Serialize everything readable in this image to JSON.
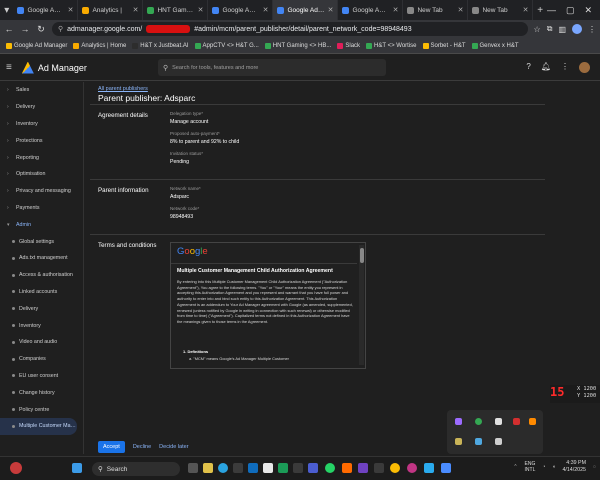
{
  "browser": {
    "tabs": [
      {
        "label": "Google A…",
        "color": "#4285f4"
      },
      {
        "label": "Analytics |",
        "color": "#f9ab00"
      },
      {
        "label": "HNT Gam…",
        "color": "#34a853"
      },
      {
        "label": "Google A…",
        "color": "#4285f4"
      },
      {
        "label": "Google Ad…",
        "color": "#4285f4"
      },
      {
        "label": "Google A…",
        "color": "#4285f4"
      },
      {
        "label": "New Tab",
        "color": "#888888"
      },
      {
        "label": "New Tab",
        "color": "#888888"
      }
    ],
    "url_host": "admanager.google.com/",
    "url_path": "#admin/mcm/parent_publisher/detail/parent_network_code=98948493",
    "bookmarks": [
      {
        "label": "Google Ad Manager",
        "color": "#fbbc04"
      },
      {
        "label": "Analytics | Home",
        "color": "#f9ab00"
      },
      {
        "label": "H&T  x Justbeat.AI",
        "color": "#2d2d2d"
      },
      {
        "label": "AppCTV <> H&T G...",
        "color": "#34a853"
      },
      {
        "label": "HNT Gaming <> HB...",
        "color": "#34a853"
      },
      {
        "label": "Slack",
        "color": "#e01e5a"
      },
      {
        "label": "H&T <> Wortise",
        "color": "#34a853"
      },
      {
        "label": "Sorbet - H&T",
        "color": "#fbbc04"
      },
      {
        "label": "Genvex x H&T",
        "color": "#34a853"
      }
    ]
  },
  "app": {
    "name": "Ad Manager",
    "search_placeholder": "Search for tools, features and more"
  },
  "sidebar": {
    "items": [
      {
        "label": "Sales",
        "kind": "top"
      },
      {
        "label": "Delivery",
        "kind": "top"
      },
      {
        "label": "Inventory",
        "kind": "top"
      },
      {
        "label": "Protections",
        "kind": "top"
      },
      {
        "label": "Reporting",
        "kind": "top"
      },
      {
        "label": "Optimisation",
        "kind": "top"
      },
      {
        "label": "Privacy and messaging",
        "kind": "top"
      },
      {
        "label": "Payments",
        "kind": "top"
      },
      {
        "label": "Admin",
        "kind": "admin"
      },
      {
        "label": "Global settings",
        "kind": "sub"
      },
      {
        "label": "Ads.txt management",
        "kind": "sub"
      },
      {
        "label": "Access & authorisation",
        "kind": "sub"
      },
      {
        "label": "Linked accounts",
        "kind": "sub"
      },
      {
        "label": "Delivery",
        "kind": "sub"
      },
      {
        "label": "Inventory",
        "kind": "sub"
      },
      {
        "label": "Video and audio",
        "kind": "sub"
      },
      {
        "label": "Companies",
        "kind": "sub"
      },
      {
        "label": "EU user consent",
        "kind": "sub"
      },
      {
        "label": "Change history",
        "kind": "sub"
      },
      {
        "label": "Policy centre",
        "kind": "sub"
      },
      {
        "label": "Multiple Customer Ma…",
        "kind": "selected"
      }
    ]
  },
  "page": {
    "breadcrumb": "All parent publishers",
    "title": "Parent publisher: Adsparc",
    "agreement": {
      "heading": "Agreement details",
      "delegation_label": "Delegation type*",
      "delegation_value": "Manage account",
      "payment_label": "Proposed auto-payment*",
      "payment_value": "8% to parent and 92% to child",
      "status_label": "Invitation status*",
      "status_value": "Pending"
    },
    "parent": {
      "heading": "Parent information",
      "name_label": "Network name*",
      "name_value": "Adsparc",
      "code_label": "Network code*",
      "code_value": "98948493"
    },
    "terms": {
      "heading": "Terms and conditions",
      "doc_title": "Multiple Customer Management Child Authorization Agreement",
      "body": "By entering into this Multiple Customer Management Child Authorization Agreement (\"Authorization Agreement\"), You agree to the following terms. \"You\" or \"Your\" means the entity you represent in accepting this Authorization Agreement and you represent and warrant that you have full power and authority to enter into and bind such entity to this Authorization Agreement. This Authorization Agreement is an addendum to Your Ad Manager agreement with Google (as amended, supplemented, renewed (unless notified by Google in writing in connection with such renewal) or otherwise modified from time to time) (\"Agreement\"). Capitalized terms not defined in this Authorization Agreement have the meanings given to those terms in the Agreement.",
      "definitions": "1. Definitions",
      "definition_a": "a. \"MCM\" means Google's Ad Manager Multiple Customer"
    },
    "actions": {
      "accept": "Accept",
      "decline": "Decline",
      "decide_later": "Decide later"
    }
  },
  "overlay": {
    "fps": "15",
    "x_readout": "X 1200",
    "y_readout": "Y 1200"
  },
  "taskbar": {
    "search": "Search",
    "lang_top": "ENG",
    "lang_bottom": "INTL",
    "time": "4:39 PM",
    "date": "4/14/2025"
  }
}
